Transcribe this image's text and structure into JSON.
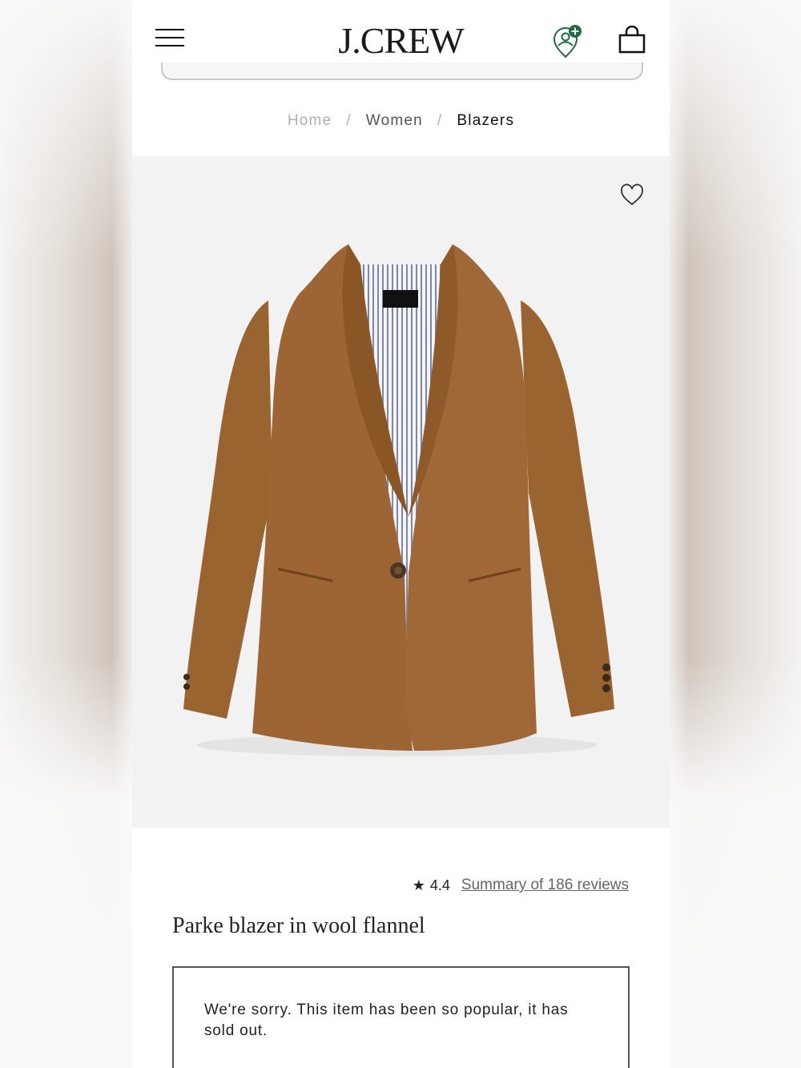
{
  "header": {
    "brand": "J.CREW",
    "menu_icon": "hamburger-menu-icon",
    "location_icon": "store-locator-pin-icon",
    "location_badge_color": "#1e6b3e",
    "bag_icon": "shopping-bag-icon"
  },
  "breadcrumb": {
    "home": "Home",
    "separator": "/",
    "women": "Women",
    "current": "Blazers"
  },
  "product": {
    "image_alt": "brown shawl-collar blazer with striped lining",
    "favorite_icon": "heart-icon",
    "rating_icon": "star-icon",
    "rating": "4.4",
    "reviews_link": "Summary of 186 reviews",
    "title": "Parke blazer in wool flannel",
    "sold_out_message": "We're sorry. This item has been so popular, it has sold out.",
    "color_swatch": "#9a6430"
  }
}
